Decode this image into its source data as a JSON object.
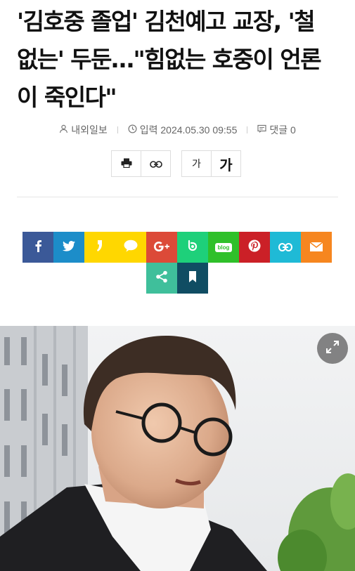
{
  "article": {
    "headline": "'김호중 졸업' 김천예고 교장, '철\n없는' 두둔…\"힘없는 호중이 언론\n이 죽인다\""
  },
  "meta": {
    "author": "내외일보",
    "date_label": "입력",
    "date": "2024.05.30 09:55",
    "comments_label": "댓글 0"
  },
  "tools": {
    "font_small": "가",
    "font_large": "가"
  },
  "share": {
    "items": [
      {
        "name": "facebook",
        "color": "#3b5998"
      },
      {
        "name": "twitter",
        "color": "#1c8dc9"
      },
      {
        "name": "kakaostory",
        "color": "#ffd700"
      },
      {
        "name": "kakaotalk",
        "color": "#ffd700"
      },
      {
        "name": "google-plus",
        "color": "#dc4a38"
      },
      {
        "name": "band",
        "color": "#1ed07a"
      },
      {
        "name": "naver-blog",
        "color": "#2fc02a"
      },
      {
        "name": "pinterest",
        "color": "#cb2027"
      },
      {
        "name": "link",
        "color": "#1fbad6"
      },
      {
        "name": "email",
        "color": "#f6861f"
      },
      {
        "name": "share",
        "color": "#3fbf9b"
      },
      {
        "name": "bookmark",
        "color": "#104d63"
      }
    ],
    "blog_label": "blog"
  }
}
